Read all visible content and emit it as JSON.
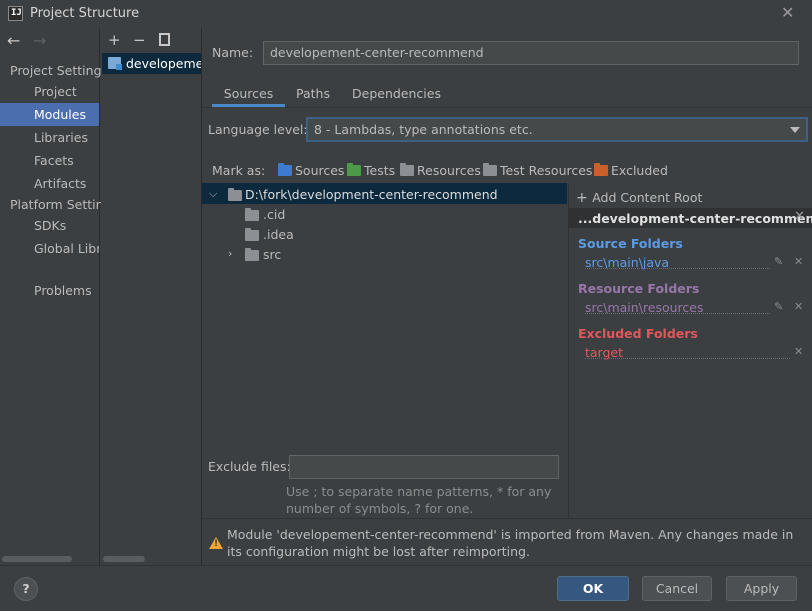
{
  "window": {
    "title": "Project Structure",
    "app_icon_text": "IJ"
  },
  "nav": {
    "project_settings": "Project Settings",
    "project_items": [
      "Project",
      "Modules",
      "Libraries",
      "Facets",
      "Artifacts"
    ],
    "platform_settings": "Platform Settings",
    "platform_items": [
      "SDKs",
      "Global Libraries"
    ],
    "problems": "Problems",
    "selected": "Modules"
  },
  "modules_toolbar": {
    "add": "+",
    "remove": "−"
  },
  "modules": [
    {
      "name": "developement-center-recommend"
    }
  ],
  "name_field": {
    "label": "Name:",
    "value": "developement-center-recommend"
  },
  "tabs": [
    "Sources",
    "Paths",
    "Dependencies"
  ],
  "language_level": {
    "label": "Language level:",
    "value": "8 - Lambdas, type annotations etc."
  },
  "mark_as": {
    "label": "Mark as:",
    "items": [
      {
        "label": "Sources",
        "color": "#3d7bd0"
      },
      {
        "label": "Tests",
        "color": "#4c9a47"
      },
      {
        "label": "Resources",
        "color": "#8c8f94"
      },
      {
        "label": "Test Resources",
        "color": "#8c8f94"
      },
      {
        "label": "Excluded",
        "color": "#c9602a"
      }
    ]
  },
  "tree": {
    "root": "D:\\fork\\development-center-recommend",
    "children": [
      ".cid",
      ".idea",
      "src"
    ]
  },
  "content_root": {
    "add_label": "Add Content Root",
    "title": "...development-center-recommend",
    "source_folders": {
      "title": "Source Folders",
      "paths": [
        "src\\main\\java"
      ],
      "color": "#5c9ce6"
    },
    "resource_folders": {
      "title": "Resource Folders",
      "paths": [
        "src\\main\\resources"
      ],
      "color": "#9876aa"
    },
    "excluded_folders": {
      "title": "Excluded Folders",
      "paths": [
        "target"
      ],
      "color": "#e0575b"
    }
  },
  "exclude_files": {
    "label": "Exclude files:",
    "value": "",
    "hint": "Use ; to separate name patterns, * for any number of symbols, ? for one."
  },
  "warning": "Module 'developement-center-recommend' is imported from Maven. Any changes made in its configuration might be lost after reimporting.",
  "buttons": {
    "help": "?",
    "ok": "OK",
    "cancel": "Cancel",
    "apply": "Apply"
  }
}
